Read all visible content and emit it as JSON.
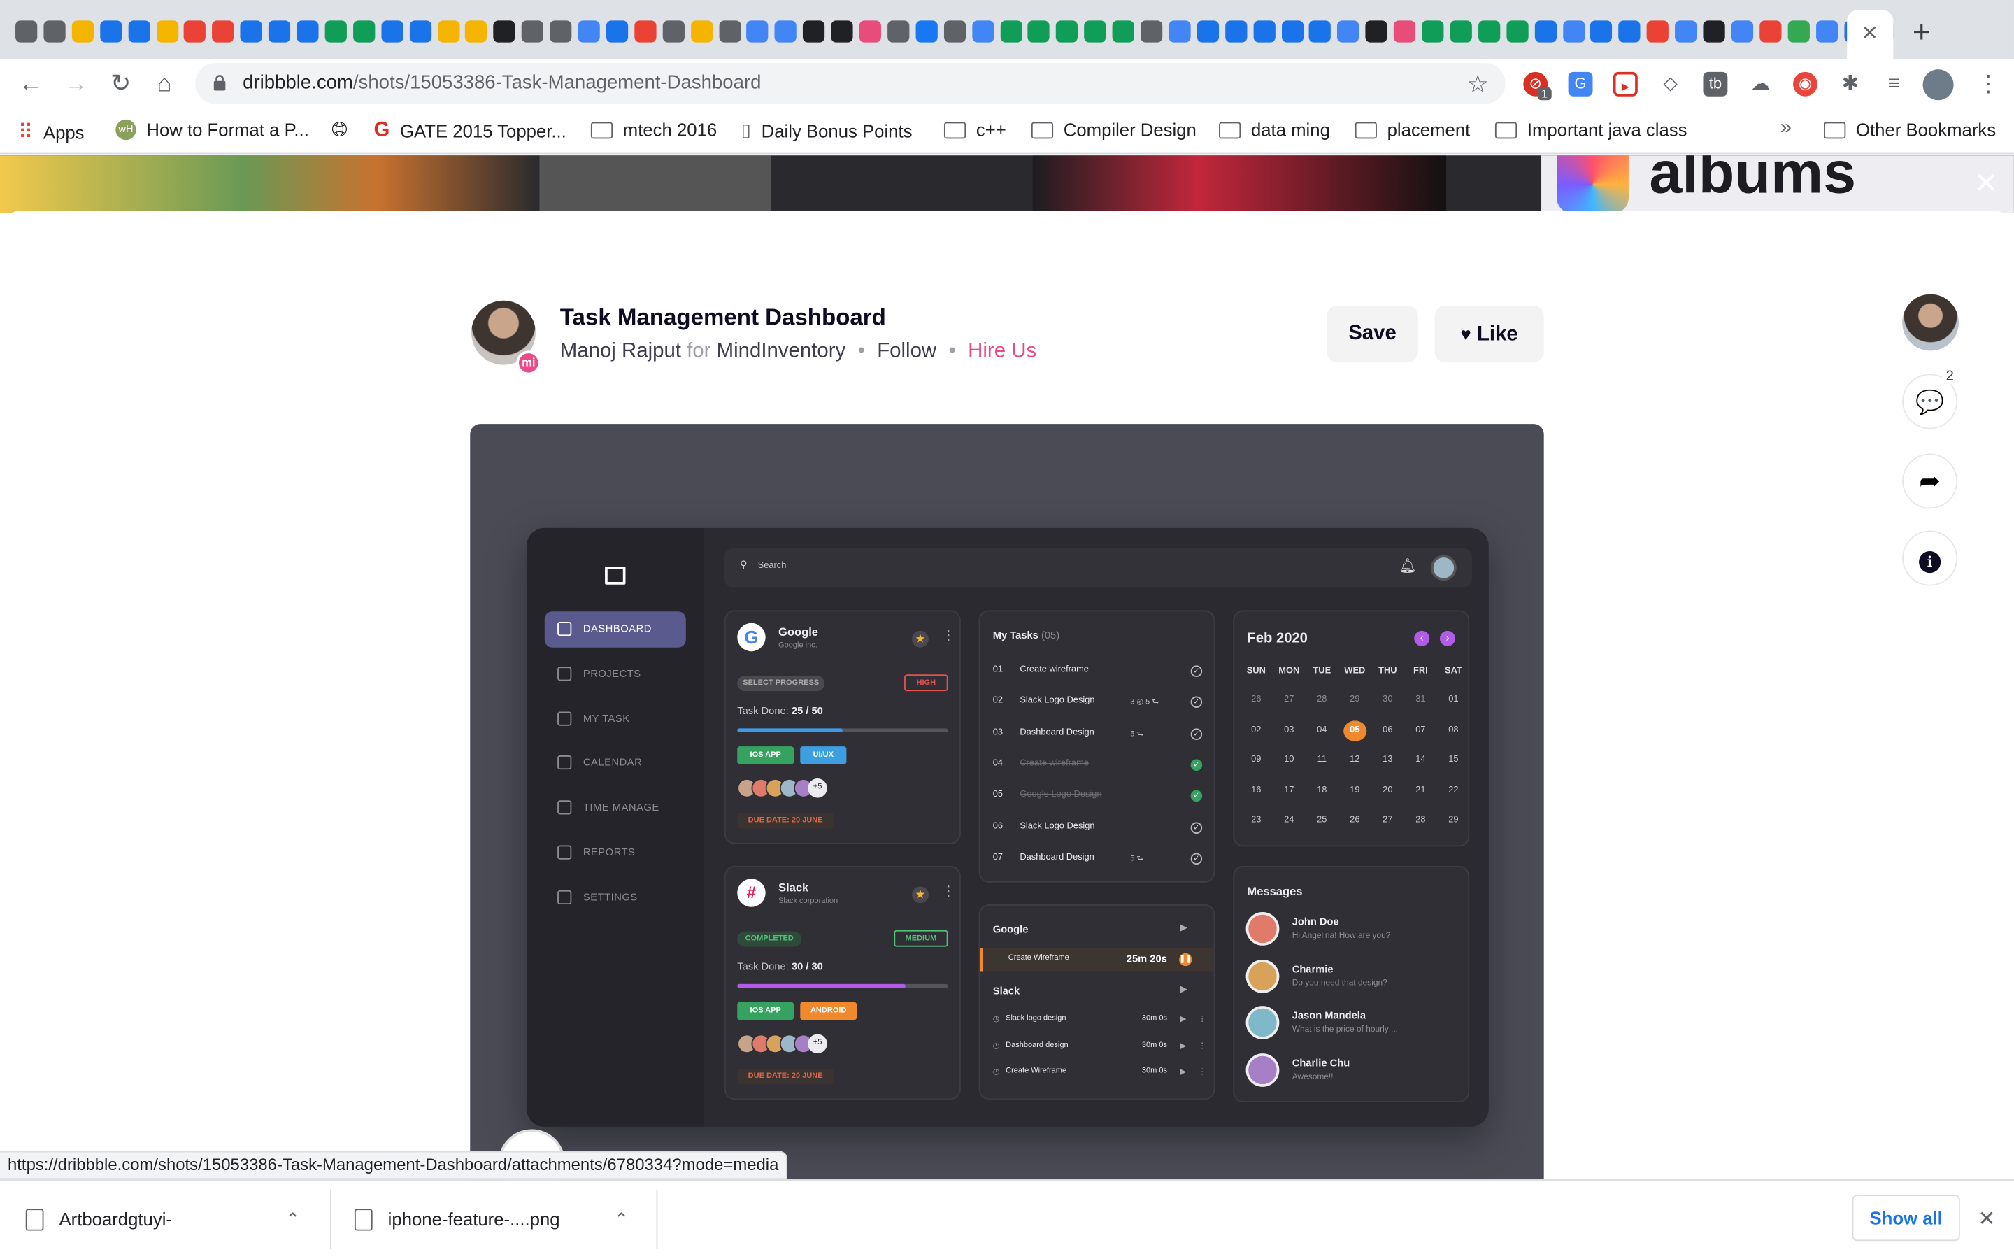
{
  "browser": {
    "url_domain": "dribbble.com",
    "url_path": "/shots/15053386-Task-Management-Dashboard",
    "tab_colors": [
      "#5f6368",
      "#5f6368",
      "#f4b400",
      "#1a73e8",
      "#1a73e8",
      "#f4b400",
      "#ea4335",
      "#ea4335",
      "#1a73e8",
      "#1a73e8",
      "#1a73e8",
      "#0f9d58",
      "#0f9d58",
      "#1a73e8",
      "#1a73e8",
      "#f4b400",
      "#f4b400",
      "#202124",
      "#5f6368",
      "#5f6368",
      "#4285f4",
      "#1a73e8",
      "#ea4335",
      "#5f6368",
      "#f4b400",
      "#5f6368",
      "#4285f4",
      "#4285f4",
      "#202124",
      "#202124",
      "#e84d7a",
      "#5f6368",
      "#1877f2",
      "#5f6368",
      "#4285f4",
      "#0f9d58",
      "#0f9d58",
      "#0f9d58",
      "#0f9d58",
      "#0f9d58",
      "#5f6368",
      "#4285f4",
      "#1a73e8",
      "#1a73e8",
      "#1a73e8",
      "#1a73e8",
      "#1a73e8",
      "#4285f4",
      "#202124",
      "#e84d7a",
      "#0f9d58",
      "#0f9d58",
      "#0f9d58",
      "#0f9d58",
      "#1a73e8",
      "#4285f4",
      "#1a73e8",
      "#1a73e8",
      "#ea4335",
      "#4285f4",
      "#202124",
      "#4285f4",
      "#ea4335",
      "#34a853",
      "#4285f4",
      "#1a73e8",
      "#0f9d58"
    ],
    "bookmarks": [
      {
        "label": "Apps",
        "icon": "apps-grid-icon"
      },
      {
        "label": "How to Format a P...",
        "icon": "wikihow-icon"
      },
      {
        "label": "",
        "icon": "globe-icon"
      },
      {
        "label": "GATE 2015 Topper...",
        "icon": "gate-icon"
      },
      {
        "label": "mtech 2016",
        "icon": "folder-icon"
      },
      {
        "label": "Daily Bonus Points",
        "icon": "bookmark-page-icon"
      },
      {
        "label": "c++",
        "icon": "folder-icon"
      },
      {
        "label": "Compiler Design",
        "icon": "folder-icon"
      },
      {
        "label": "data ming",
        "icon": "folder-icon"
      },
      {
        "label": "placement",
        "icon": "folder-icon"
      },
      {
        "label": "Important java class",
        "icon": "folder-icon"
      }
    ],
    "overflow_label": "»",
    "other_bookmarks": "Other Bookmarks",
    "new_tab_label": "+",
    "extension_badge": "1"
  },
  "background": {
    "albums_text": "albums"
  },
  "shot": {
    "title": "Task Management Dashboard",
    "author": "Manoj Rajput",
    "for_label": "for",
    "team": "MindInventory",
    "follow_label": "Follow",
    "hire_label": "Hire Us",
    "save_label": "Save",
    "like_label": "Like",
    "comment_count": "2"
  },
  "dashboard": {
    "search_placeholder": "Search",
    "nav": [
      {
        "label": "DASHBOARD",
        "active": true
      },
      {
        "label": "PROJECTS"
      },
      {
        "label": "MY TASK"
      },
      {
        "label": "CALENDAR"
      },
      {
        "label": "TIME MANAGE"
      },
      {
        "label": "REPORTS"
      },
      {
        "label": "SETTINGS"
      }
    ],
    "google_card": {
      "name": "Google",
      "company": "Google inc.",
      "status": "SELECT PROGRESS",
      "priority": "HIGH",
      "task_label": "Task Done:",
      "task_done": "25 / 50",
      "progress": 0.5,
      "tag1": "IOS APP",
      "tag2": "UI/UX",
      "more": "+5",
      "due": "DUE DATE: 20 JUNE"
    },
    "slack_card": {
      "name": "Slack",
      "company": "Slack corporation",
      "status": "COMPLETED",
      "priority": "MEDIUM",
      "task_label": "Task Done:",
      "task_done": "30 / 30",
      "progress": 0.8,
      "tag1": "IOS APP",
      "tag2": "ANDROID",
      "more": "+5",
      "due": "DUE DATE: 20 JUNE"
    },
    "tasks": {
      "title": "My Tasks",
      "count": "(05)",
      "items": [
        {
          "num": "01",
          "label": "Create wireframe",
          "meta": ""
        },
        {
          "num": "02",
          "label": "Slack Logo Design",
          "meta": "3 ◎   5 ⮑"
        },
        {
          "num": "03",
          "label": "Dashboard Design",
          "meta": "5 ⮑"
        },
        {
          "num": "04",
          "label": "Create wireframe",
          "meta": "",
          "done": true
        },
        {
          "num": "05",
          "label": "Google Logo Design",
          "meta": "",
          "done": true
        },
        {
          "num": "06",
          "label": "Slack Logo Design",
          "meta": ""
        },
        {
          "num": "07",
          "label": "Dashboard Design",
          "meta": "5 ⮑"
        }
      ]
    },
    "timer": {
      "g_title": "Google",
      "g_task": "Create Wireframe",
      "g_time": "25m 20s",
      "s_title": "Slack",
      "s_items": [
        {
          "label": "Slack logo design",
          "time": "30m 0s"
        },
        {
          "label": "Dashboard design",
          "time": "30m 0s"
        },
        {
          "label": "Create Wireframe",
          "time": "30m 0s"
        }
      ]
    },
    "calendar": {
      "month": "Feb 2020",
      "days": [
        "SUN",
        "MON",
        "TUE",
        "WED",
        "THU",
        "FRI",
        "SAT"
      ],
      "weeks": [
        [
          "26",
          "27",
          "28",
          "29",
          "30",
          "31",
          "01"
        ],
        [
          "02",
          "03",
          "04",
          "05",
          "06",
          "07",
          "08"
        ],
        [
          "09",
          "10",
          "11",
          "12",
          "13",
          "14",
          "15"
        ],
        [
          "16",
          "17",
          "18",
          "19",
          "20",
          "21",
          "22"
        ],
        [
          "23",
          "24",
          "25",
          "26",
          "27",
          "28",
          "29"
        ]
      ],
      "selected": "05"
    },
    "messages": {
      "title": "Messages",
      "items": [
        {
          "name": "John Doe",
          "text": "Hi Angelina! How are you?",
          "color": "#e07a6a"
        },
        {
          "name": "Charmie",
          "text": "Do you need that design?",
          "color": "#d9a25b"
        },
        {
          "name": "Jason Mandela",
          "text": "What is the price of hourly ...",
          "color": "#7fb8c9"
        },
        {
          "name": "Charlie Chu",
          "text": "Awesome!!",
          "color": "#a77fc6"
        }
      ]
    }
  },
  "statusbar": {
    "url": "https://dribbble.com/shots/15053386-Task-Management-Dashboard/attachments/6780334?mode=media"
  },
  "downloads": {
    "items": [
      {
        "name": "Artboardgtuyi-"
      },
      {
        "name": "iphone-feature-....png"
      }
    ],
    "show_all": "Show all"
  }
}
